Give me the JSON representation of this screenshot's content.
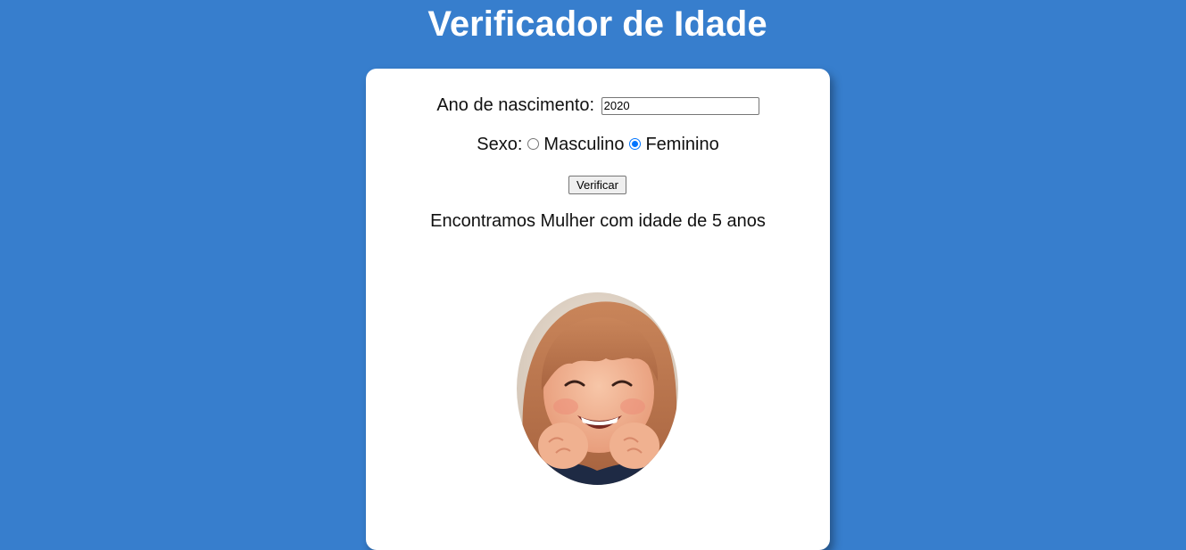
{
  "page": {
    "title": "Verificador de Idade",
    "background_color": "#377ecd"
  },
  "form": {
    "year_label": "Ano de nascimento:",
    "year_value": "2020",
    "sex_label": "Sexo:",
    "sex_options": [
      {
        "label": "Masculino",
        "checked": false
      },
      {
        "label": "Feminino",
        "checked": true
      }
    ],
    "verify_button_label": "Verificar"
  },
  "result": {
    "text": "Encontramos Mulher com idade de 5 anos",
    "photo_icon": "smiling-girl-photo"
  }
}
